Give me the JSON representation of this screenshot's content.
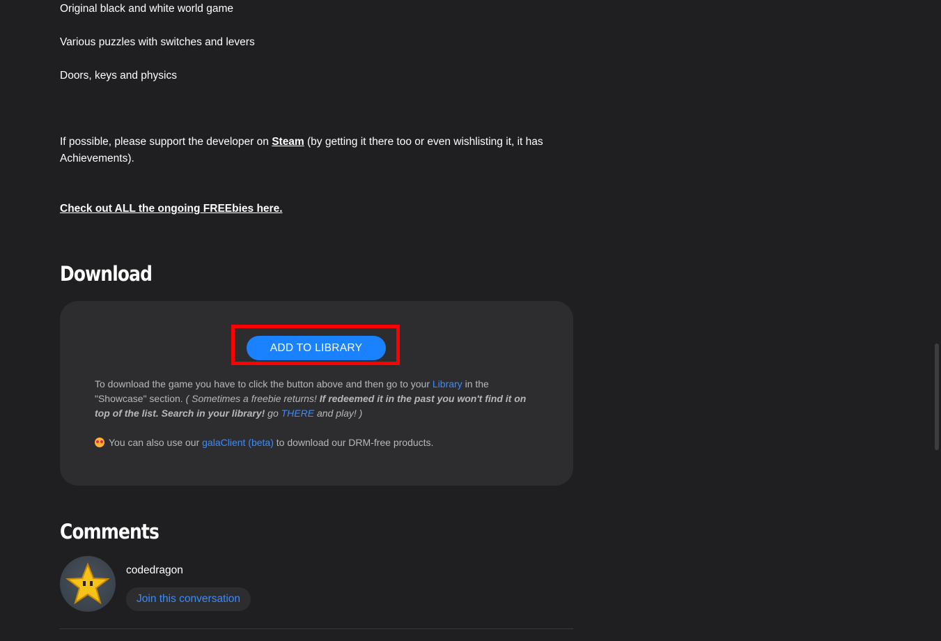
{
  "features": [
    "Original black and white world game",
    "Various puzzles with switches and levers",
    "Doors, keys and physics"
  ],
  "support": {
    "prefix": "If possible, please support the developer on ",
    "steam_link": "Steam",
    "suffix": " (by getting it there too or even wishlisting it, it has Achievements)."
  },
  "freebies_link": "Check out ALL the ongoing FREEbies here.",
  "download": {
    "title": "Download",
    "add_button": "ADD TO LIBRARY",
    "info_prefix": "To download the game you have to click the button above and then go to your ",
    "library_link": "Library",
    "info_middle": " in the \"Showcase\" section. ",
    "italic_start": "( Sometimes a freebie returns! ",
    "italic_bold": "If redeemed it in the past you won't find it on top of the list. Search in your library!",
    "italic_go": " go ",
    "there_link": "THERE",
    "italic_end": " and play! )",
    "drm_prefix": "You can also use our ",
    "galaclient_link": "galaClient (beta)",
    "drm_suffix": " to download our DRM-free products."
  },
  "comments": {
    "title": "Comments",
    "username": "codedragon",
    "join_button": "Join this conversation"
  },
  "icons": {
    "emoji": "star-struck-emoji-icon",
    "avatar": "pixel-star-avatar"
  },
  "colors": {
    "background": "#1f1f21",
    "box": "#2d2d30",
    "accent": "#1a82ff",
    "link": "#3a8cff",
    "highlight": "#ff0000"
  }
}
